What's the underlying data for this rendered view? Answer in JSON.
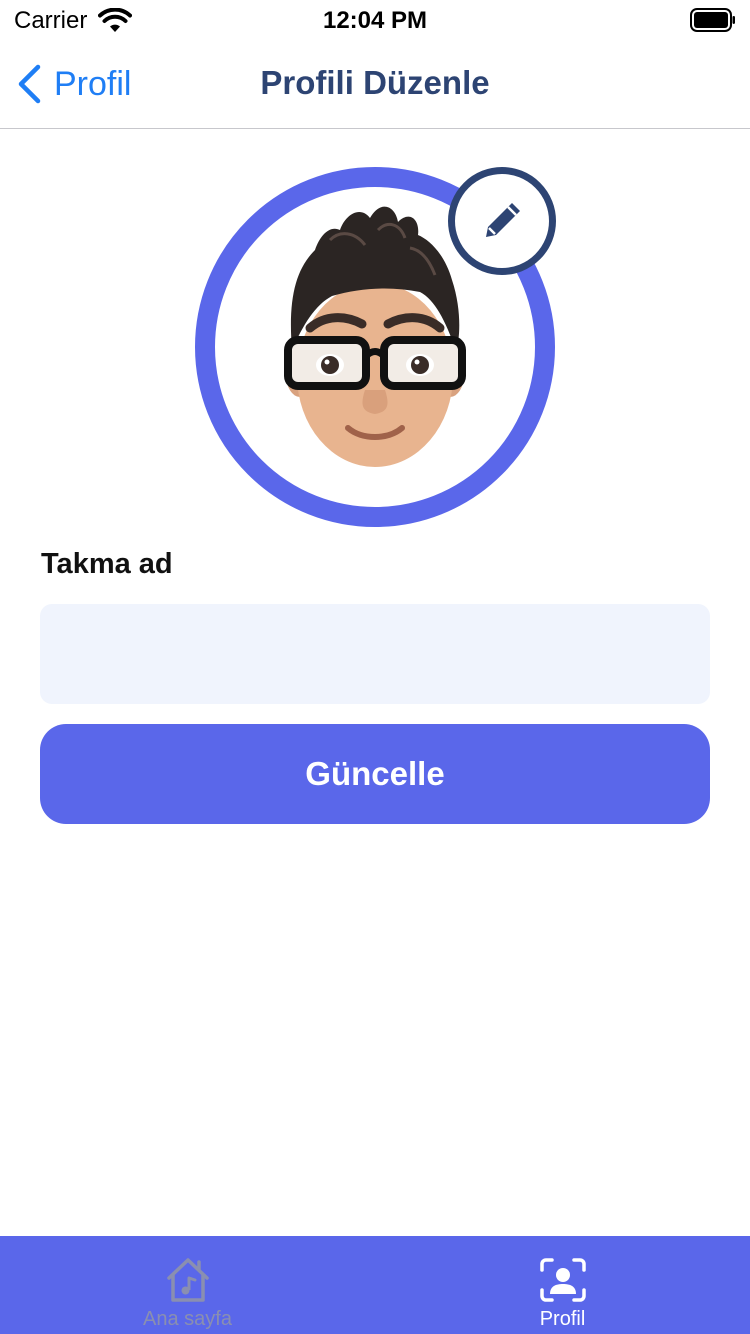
{
  "status_bar": {
    "carrier": "Carrier",
    "time": "12:04 PM",
    "wifi_icon": "wifi-icon",
    "battery_icon": "battery-full-icon"
  },
  "nav": {
    "back_label": "Profil",
    "back_icon": "chevron-left-icon",
    "title": "Profili Düzenle"
  },
  "avatar": {
    "description_icon": "memoji-avatar",
    "edit_icon": "pencil-icon"
  },
  "form": {
    "nickname_label": "Takma ad",
    "nickname_value": "",
    "nickname_placeholder": "",
    "update_label": "Güncelle"
  },
  "tab_bar": {
    "items": [
      {
        "label": "Ana sayfa",
        "icon": "home-music-icon",
        "active": false
      },
      {
        "label": "Profil",
        "icon": "profile-scan-icon",
        "active": true
      }
    ]
  },
  "colors": {
    "accent": "#5a67ea",
    "navy": "#2d4473",
    "link": "#1f7ef5",
    "input_bg": "#f0f4fd"
  }
}
